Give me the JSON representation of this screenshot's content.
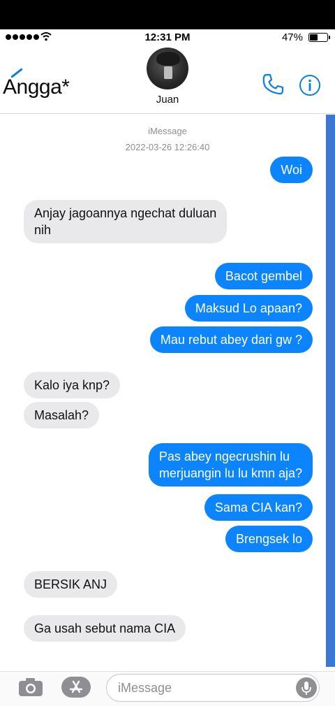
{
  "status_bar": {
    "time": "12:31 PM",
    "battery": "47%",
    "battery_level": 0.47
  },
  "header": {
    "back_label": "Angga*",
    "contact_name": "Juan",
    "call_icon": "phone-icon",
    "info_icon": "info-icon"
  },
  "thread": {
    "service": "iMessage",
    "timestamp": "2022-03-26 12:26:40",
    "messages": [
      {
        "from": "me",
        "text": "Woi"
      },
      {
        "from": "them",
        "text": "Anjay jagoannya ngechat duluan\nnih"
      },
      {
        "from": "me",
        "text": "Bacot gembel"
      },
      {
        "from": "me",
        "text": "Maksud Lo apaan?"
      },
      {
        "from": "me",
        "text": "Mau rebut abey dari gw ?"
      },
      {
        "from": "them",
        "text": "Kalo iya knp?"
      },
      {
        "from": "them",
        "text": "Masalah?"
      },
      {
        "from": "me",
        "text": "Pas abey ngecrushin lu\nmerjuangin lu lu kmn aja?"
      },
      {
        "from": "me",
        "text": "Sama CIA kan?"
      },
      {
        "from": "me",
        "text": "Brengsek lo"
      },
      {
        "from": "them",
        "text": "BERSIK ANJ"
      },
      {
        "from": "them",
        "text": "Ga usah sebut nama CIA"
      }
    ]
  },
  "composer": {
    "placeholder": "iMessage",
    "camera_icon": "camera-icon",
    "apps_icon": "app-store-icon",
    "mic_icon": "microphone-icon"
  },
  "colors": {
    "outgoing": "#0b84fe",
    "incoming": "#e9e9eb",
    "accent": "#0b7de8"
  }
}
